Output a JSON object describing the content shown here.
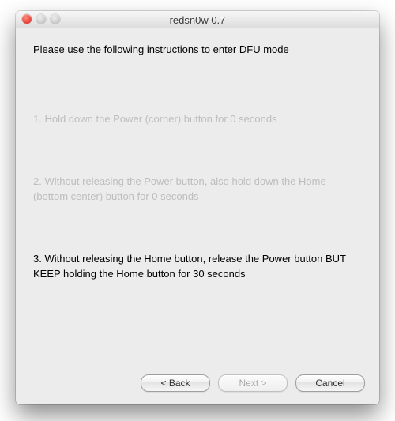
{
  "window": {
    "title": "redsn0w 0.7"
  },
  "heading": "Please use the following instructions to enter DFU mode",
  "steps": {
    "s1": "1. Hold down the Power (corner) button for 0 seconds",
    "s2": "2. Without releasing the Power button, also hold down the Home (bottom center) button for 0 seconds",
    "s3": "3. Without releasing the Home button, release the Power button BUT KEEP holding the Home button for 30 seconds"
  },
  "buttons": {
    "back": "< Back",
    "next": "Next >",
    "cancel": "Cancel"
  }
}
